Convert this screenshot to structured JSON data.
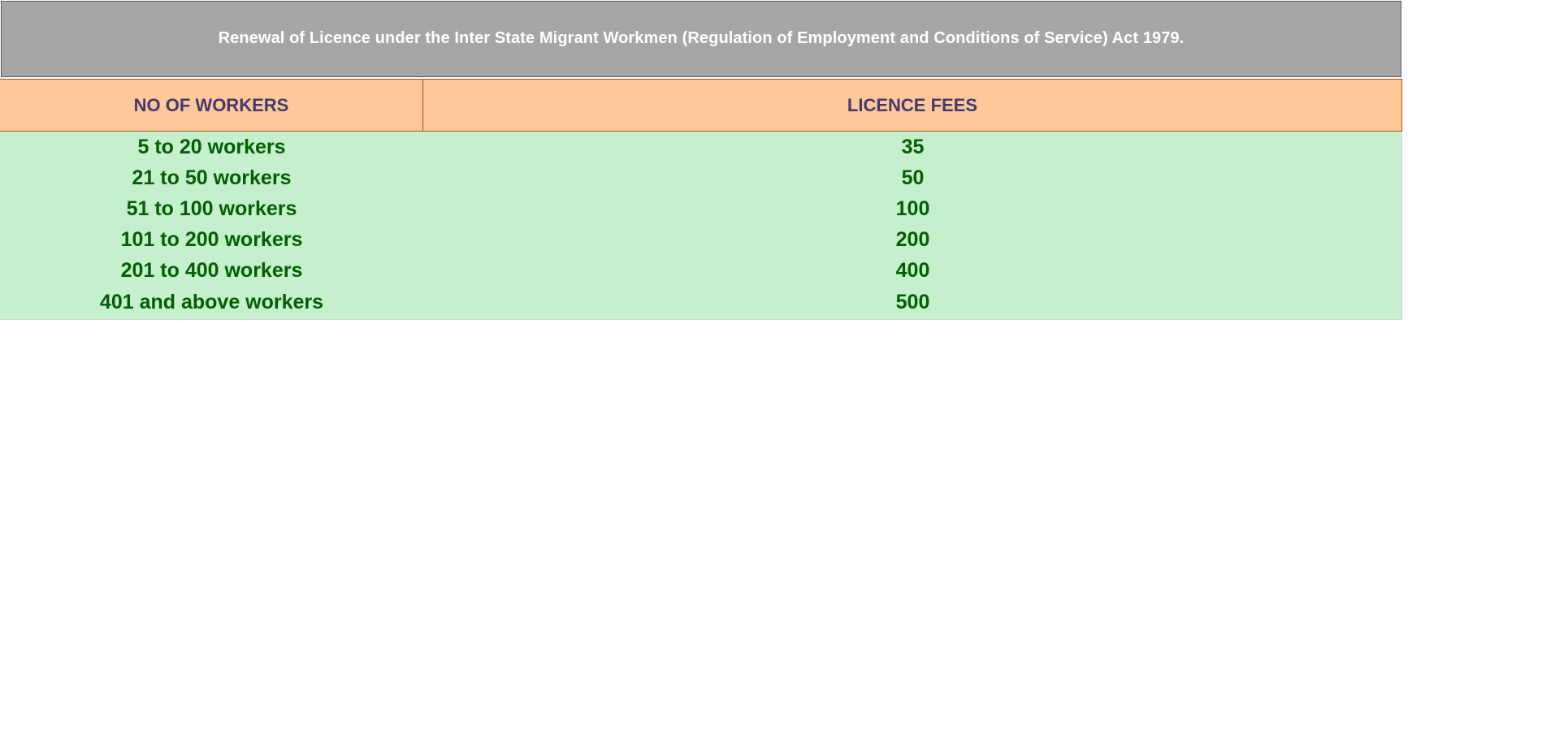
{
  "title": "Renewal of Licence under the Inter State Migrant Workmen (Regulation of Employment and Conditions of Service) Act 1979.",
  "table": {
    "headers": [
      "NO OF WORKERS",
      "LICENCE FEES"
    ],
    "rows": [
      [
        "5 to 20 workers",
        "35"
      ],
      [
        "21 to 50 workers",
        "50"
      ],
      [
        "51 to 100 workers",
        "100"
      ],
      [
        "101 to 200 workers",
        "200"
      ],
      [
        "201 to 400 workers",
        "400"
      ],
      [
        "401 and above workers",
        "500"
      ]
    ]
  },
  "colors": {
    "title_bg": "#a6a6a6",
    "title_text": "#ffffff",
    "header_bg": "#ffc896",
    "header_text": "#403a75",
    "body_bg": "#c6efce",
    "body_text": "#006100"
  }
}
